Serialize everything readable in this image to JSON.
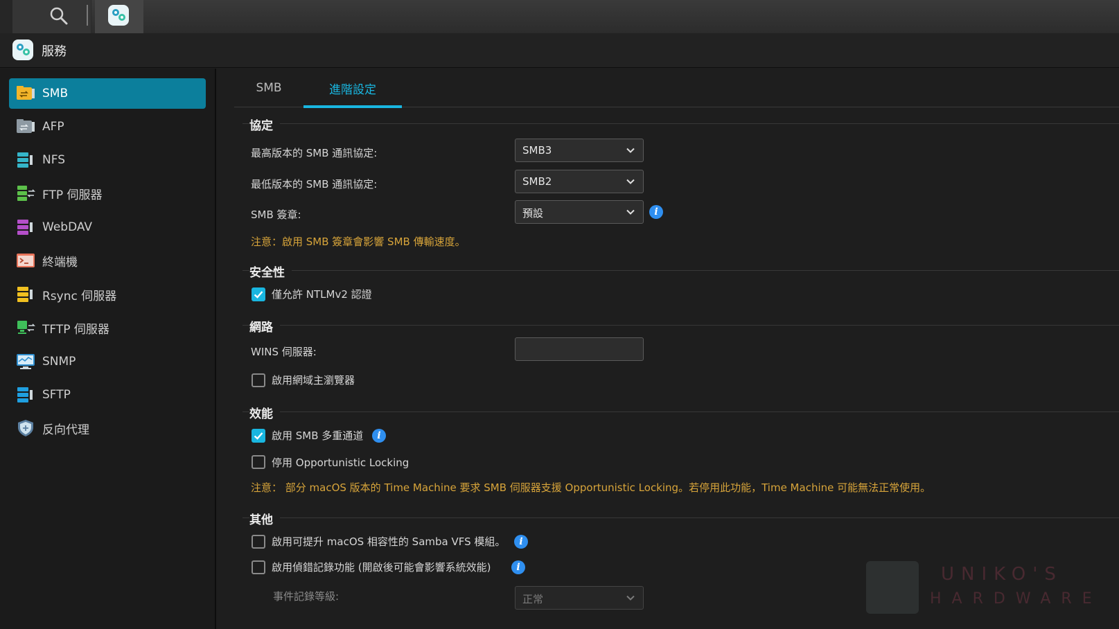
{
  "app": {
    "title": "服務"
  },
  "sidebar": {
    "items": [
      {
        "label": "SMB",
        "icon": "smb-folder-icon",
        "active": true
      },
      {
        "label": "AFP",
        "icon": "afp-folder-icon"
      },
      {
        "label": "NFS",
        "icon": "nfs-server-icon"
      },
      {
        "label": "FTP 伺服器",
        "icon": "ftp-server-icon"
      },
      {
        "label": "WebDAV",
        "icon": "webdav-server-icon"
      },
      {
        "label": "終端機",
        "icon": "terminal-icon"
      },
      {
        "label": "Rsync 伺服器",
        "icon": "rsync-server-icon"
      },
      {
        "label": "TFTP 伺服器",
        "icon": "tftp-server-icon"
      },
      {
        "label": "SNMP",
        "icon": "snmp-monitor-icon"
      },
      {
        "label": "SFTP",
        "icon": "sftp-server-icon"
      },
      {
        "label": "反向代理",
        "icon": "shield-icon"
      }
    ]
  },
  "tabs": [
    {
      "label": "SMB",
      "active": false
    },
    {
      "label": "進階設定",
      "active": true
    }
  ],
  "sections": {
    "protocol": {
      "heading": "協定",
      "max_label": "最高版本的 SMB 通訊協定:",
      "max_value": "SMB3",
      "min_label": "最低版本的 SMB 通訊協定:",
      "min_value": "SMB2",
      "signing_label": "SMB 簽章:",
      "signing_value": "預設",
      "note": "注意：啟用 SMB 簽章會影響 SMB 傳輸速度。"
    },
    "security": {
      "heading": "安全性",
      "ntlm_label": "僅允許 NTLMv2 認證",
      "ntlm_checked": true
    },
    "network": {
      "heading": "網路",
      "wins_label": "WINS 伺服器:",
      "wins_value": "",
      "browser_label": "啟用網域主瀏覽器",
      "browser_checked": false
    },
    "performance": {
      "heading": "效能",
      "multichannel_label": "啟用 SMB 多重通道",
      "multichannel_checked": true,
      "oplock_label": "停用 Opportunistic Locking",
      "oplock_checked": false,
      "note": "注意： 部分 macOS 版本的 Time Machine 要求 SMB 伺服器支援 Opportunistic Locking。若停用此功能，Time Machine 可能無法正常使用。"
    },
    "other": {
      "heading": "其他",
      "vfs_label": "啟用可提升 macOS 相容性的 Samba VFS 模組。",
      "vfs_checked": false,
      "debug_label": "啟用偵錯記錄功能 (開啟後可能會影響系統效能)",
      "debug_checked": false,
      "log_level_label": "事件記錄等級:",
      "log_level_value": "正常"
    }
  },
  "watermark": {
    "line1": "UNIKO'S",
    "line2": "HARDWARE"
  },
  "colors": {
    "accent": "#19b6e0",
    "active_nav": "#0c7f9c",
    "note": "#d7a43a",
    "info": "#2f8ff0"
  }
}
